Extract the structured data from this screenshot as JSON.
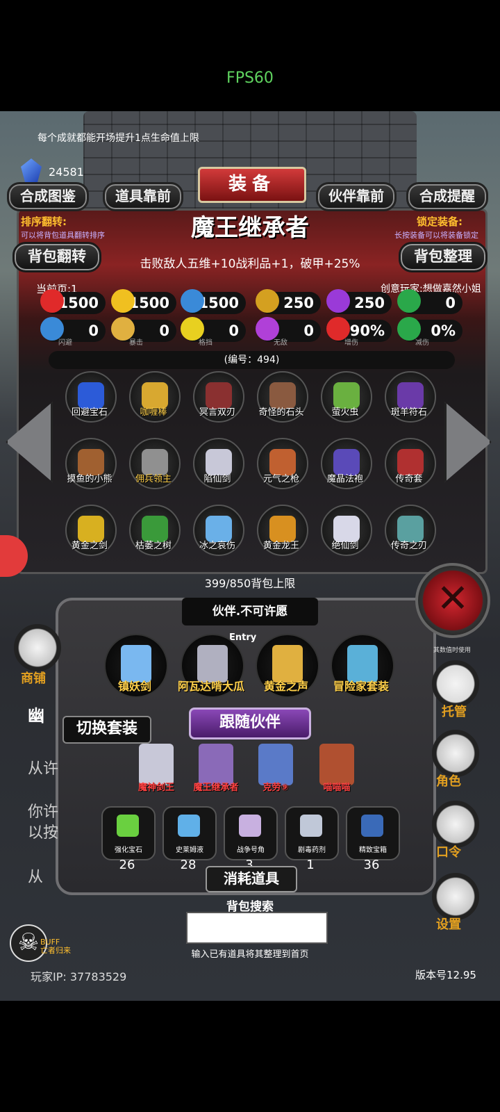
{
  "fps": "FPS60",
  "tip": "每个成就都能开场提升1点生命值上限",
  "gold": "24581",
  "top_buttons": [
    "合成图鉴",
    "道具靠前",
    "伙伴靠前",
    "合成提醒"
  ],
  "title": "装备",
  "sort": {
    "label": "排序翻转:",
    "hint": "可以将背包道具翻转排序"
  },
  "lock": {
    "label": "锁定装备:",
    "hint": "长按装备可以将装备锁定"
  },
  "item_name": "魔王继承者",
  "item_desc": "击败敌人五维+10战利品+1，破甲+25%",
  "left_btn": "背包翻转",
  "right_btn": "背包整理",
  "current_page": "当前页:1",
  "creator": "创意玩家:想做嘉然小姐",
  "stats_row1": [
    {
      "value": "1500",
      "icon": "heart-icon",
      "color": "#e02a2a"
    },
    {
      "value": "1500",
      "icon": "strength-icon",
      "color": "#f0c020"
    },
    {
      "value": "1500",
      "icon": "armor-icon",
      "color": "#3a8ad8"
    },
    {
      "value": "250",
      "icon": "sword-icon",
      "color": "#d4a020"
    },
    {
      "value": "250",
      "icon": "lightning-icon",
      "color": "#9a3ad8"
    },
    {
      "value": "0",
      "icon": "clover-icon",
      "color": "#2aa84a"
    }
  ],
  "stats_row2": [
    {
      "value": "0",
      "sub": "闪避",
      "icon": "dodge-icon",
      "color": "#3a8ad8"
    },
    {
      "value": "0",
      "sub": "暴击",
      "icon": "crit-icon",
      "color": "#e0b040"
    },
    {
      "value": "0",
      "sub": "格挡",
      "icon": "block-icon",
      "color": "#e8d020"
    },
    {
      "value": "0",
      "sub": "无敌",
      "icon": "invincible-icon",
      "color": "#b040d8"
    },
    {
      "value": "90%",
      "sub": "增伤",
      "icon": "damage-icon",
      "color": "#e02a2a"
    },
    {
      "value": "0%",
      "sub": "减伤",
      "icon": "reduce-icon",
      "color": "#2aa84a"
    }
  ],
  "serial": "(编号：494)",
  "items": [
    {
      "label": "回避宝石",
      "color": "#2c5bd8",
      "gold": false
    },
    {
      "label": "咖喱棒",
      "color": "#d8a830",
      "gold": true
    },
    {
      "label": "冥言双刃",
      "color": "#8a3030",
      "gold": false
    },
    {
      "label": "奇怪的石头",
      "color": "#8a5a40",
      "gold": false
    },
    {
      "label": "萤火虫",
      "color": "#6ab040",
      "gold": false
    },
    {
      "label": "斑羊符石",
      "color": "#6a3aa8",
      "gold": false
    },
    {
      "label": "摸鱼的小熊",
      "color": "#a06030",
      "gold": false
    },
    {
      "label": "佣兵领主",
      "color": "#909090",
      "gold": true
    },
    {
      "label": "陷仙剑",
      "color": "#c8c8d8",
      "gold": false
    },
    {
      "label": "元气之枪",
      "color": "#c06030",
      "gold": false
    },
    {
      "label": "魔晶法袍",
      "color": "#5a4ab8",
      "gold": false
    },
    {
      "label": "传奇套",
      "color": "#b03030",
      "gold": false
    },
    {
      "label": "黄金之剑",
      "color": "#d8b020",
      "gold": false
    },
    {
      "label": "枯萎之树",
      "color": "#3a9a3a",
      "gold": false
    },
    {
      "label": "冰之哀伤",
      "color": "#6ab0e8",
      "gold": false
    },
    {
      "label": "黄金龙王",
      "color": "#d89020",
      "gold": false
    },
    {
      "label": "绝仙剑",
      "color": "#d8d8e8",
      "gold": false
    },
    {
      "label": "传奇之刃",
      "color": "#5aa0a0",
      "gold": false
    }
  ],
  "bag_limit": "399/850背包上限",
  "partner_title": "伙伴.不可许愿",
  "entry": "Entry",
  "partners": [
    {
      "label": "镇妖剑",
      "color": "#7ab8f0"
    },
    {
      "label": "阿瓦达啃大瓜",
      "color": "#b0b0c0"
    },
    {
      "label": "黄金之声",
      "color": "#e0b040"
    },
    {
      "label": "冒险家套装",
      "color": "#5ab0d8"
    }
  ],
  "switch_set": "切换套装",
  "follow_partner": "跟随伙伴",
  "followers": [
    {
      "label": "魔神剑王",
      "color": "#c8c8d8"
    },
    {
      "label": "魔王继承者",
      "color": "#8a6ab8"
    },
    {
      "label": "克劳⑨",
      "color": "#5a7ac8"
    },
    {
      "label": "喵喵喵",
      "color": "#b05030"
    }
  ],
  "consumables": [
    {
      "name": "强化宝石",
      "count": "26",
      "color": "#6ad040"
    },
    {
      "name": "史莱姆液",
      "count": "28",
      "color": "#60b0e8"
    },
    {
      "name": "战争号角",
      "count": "3",
      "color": "#c8b0e0"
    },
    {
      "name": "剧毒药剂",
      "count": "1",
      "color": "#c0c8d8"
    },
    {
      "name": "精致宝箱",
      "count": "36",
      "color": "#3a6ab8"
    }
  ],
  "consume_title": "消耗道具",
  "search_title": "背包搜索",
  "search_hint": "输入已有道具将其整理到首页",
  "left_menu": {
    "shop": "商铺"
  },
  "left_texts": [
    "幽",
    "从许",
    "你许",
    "以按",
    "从"
  ],
  "right_menu": [
    "托管",
    "角色",
    "口令",
    "设置"
  ],
  "right_small": "其数值时使用",
  "buff": {
    "line1": "BUFF",
    "line2": "亡者归来"
  },
  "player_ip": "玩家IP:  37783529",
  "version": "版本号12.95"
}
